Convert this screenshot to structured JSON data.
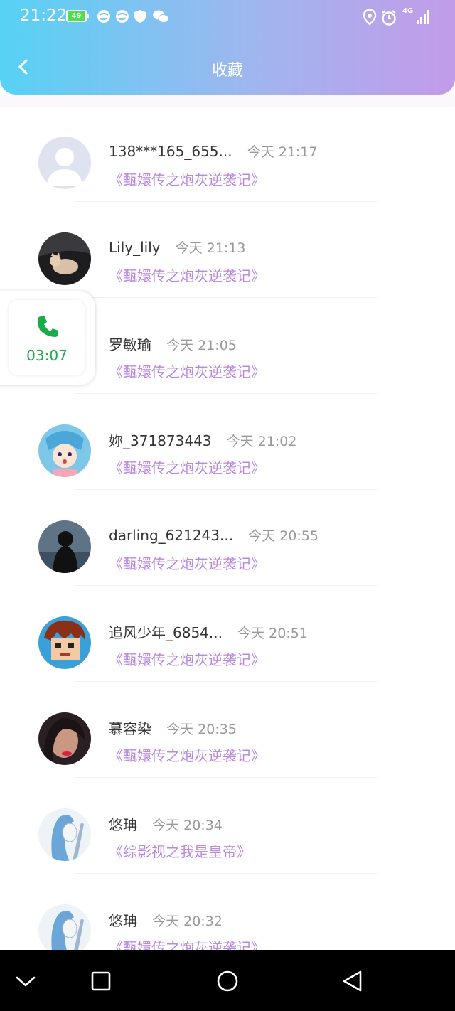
{
  "status_bar": {
    "time": "21:22",
    "battery": "49",
    "network": "4G",
    "icons": [
      "browser-icon",
      "browser-icon",
      "shield-icon",
      "wechat-icon",
      "location-icon",
      "alarm-icon",
      "signal-icon"
    ]
  },
  "header": {
    "title": "收藏",
    "back_icon": "chevron-left-icon"
  },
  "items": [
    {
      "name": "138***165_655...",
      "time": "今天 21:17",
      "book": "《甄嬛传之炮灰逆袭记》"
    },
    {
      "name": "Lily_lily",
      "time": "今天 21:13",
      "book": "《甄嬛传之炮灰逆袭记》"
    },
    {
      "name": "罗敏瑜",
      "time": "今天 21:05",
      "book": "《甄嬛传之炮灰逆袭记》"
    },
    {
      "name": "妳_371873443",
      "time": "今天 21:02",
      "book": "《甄嬛传之炮灰逆袭记》"
    },
    {
      "name": "darling_621243...",
      "time": "今天 20:55",
      "book": "《甄嬛传之炮灰逆袭记》"
    },
    {
      "name": "追风少年_6854...",
      "time": "今天 20:51",
      "book": "《甄嬛传之炮灰逆袭记》"
    },
    {
      "name": "慕容染",
      "time": "今天 20:35",
      "book": "《甄嬛传之炮灰逆袭记》"
    },
    {
      "name": "悠珃",
      "time": "今天 20:34",
      "book": "《综影视之我是皇帝》"
    },
    {
      "name": "悠珃",
      "time": "今天 20:32",
      "book": "《甄嬛传之炮灰逆袭记》"
    }
  ],
  "call_float": {
    "timer": "03:07",
    "icon": "phone-icon"
  },
  "colors": {
    "header_gradient": [
      "#56d2f4",
      "#9fb6ef",
      "#c39be8"
    ],
    "book_title": "#b887e0",
    "time_text": "#999999",
    "call_green": "#1aab4c"
  },
  "nav_bar": {
    "icons": [
      "chevron-down-icon",
      "square-icon",
      "circle-icon",
      "triangle-back-icon"
    ]
  }
}
